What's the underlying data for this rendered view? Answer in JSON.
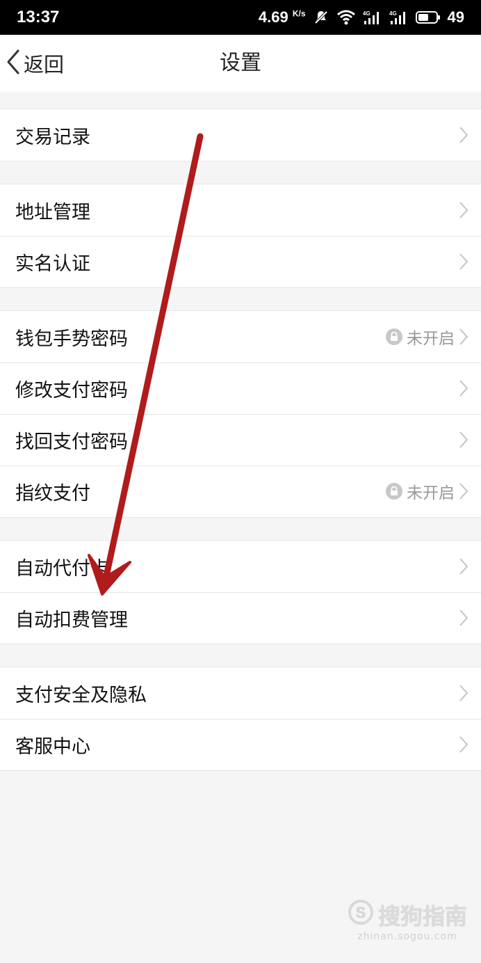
{
  "status_bar": {
    "time": "13:37",
    "speed": "4.69",
    "speed_unit": "K/s",
    "battery": "49"
  },
  "header": {
    "back_label": "返回",
    "title": "设置"
  },
  "groups": [
    {
      "items": [
        {
          "label": "交易记录"
        }
      ]
    },
    {
      "items": [
        {
          "label": "地址管理"
        },
        {
          "label": "实名认证"
        }
      ]
    },
    {
      "items": [
        {
          "label": "钱包手势密码",
          "status": "未开启"
        },
        {
          "label": "修改支付密码"
        },
        {
          "label": "找回支付密码"
        },
        {
          "label": "指纹支付",
          "status": "未开启"
        }
      ]
    },
    {
      "items": [
        {
          "label": "自动代付卡"
        },
        {
          "label": "自动扣费管理"
        }
      ]
    },
    {
      "items": [
        {
          "label": "支付安全及隐私"
        },
        {
          "label": "客服中心"
        }
      ]
    }
  ],
  "watermark": {
    "brand": "搜狗指南",
    "url": "zhinan.sogou.com"
  },
  "colors": {
    "arrow": "#b01b1b",
    "background": "#f5f5f5",
    "row_bg": "#ffffff",
    "status_text": "#999999"
  }
}
